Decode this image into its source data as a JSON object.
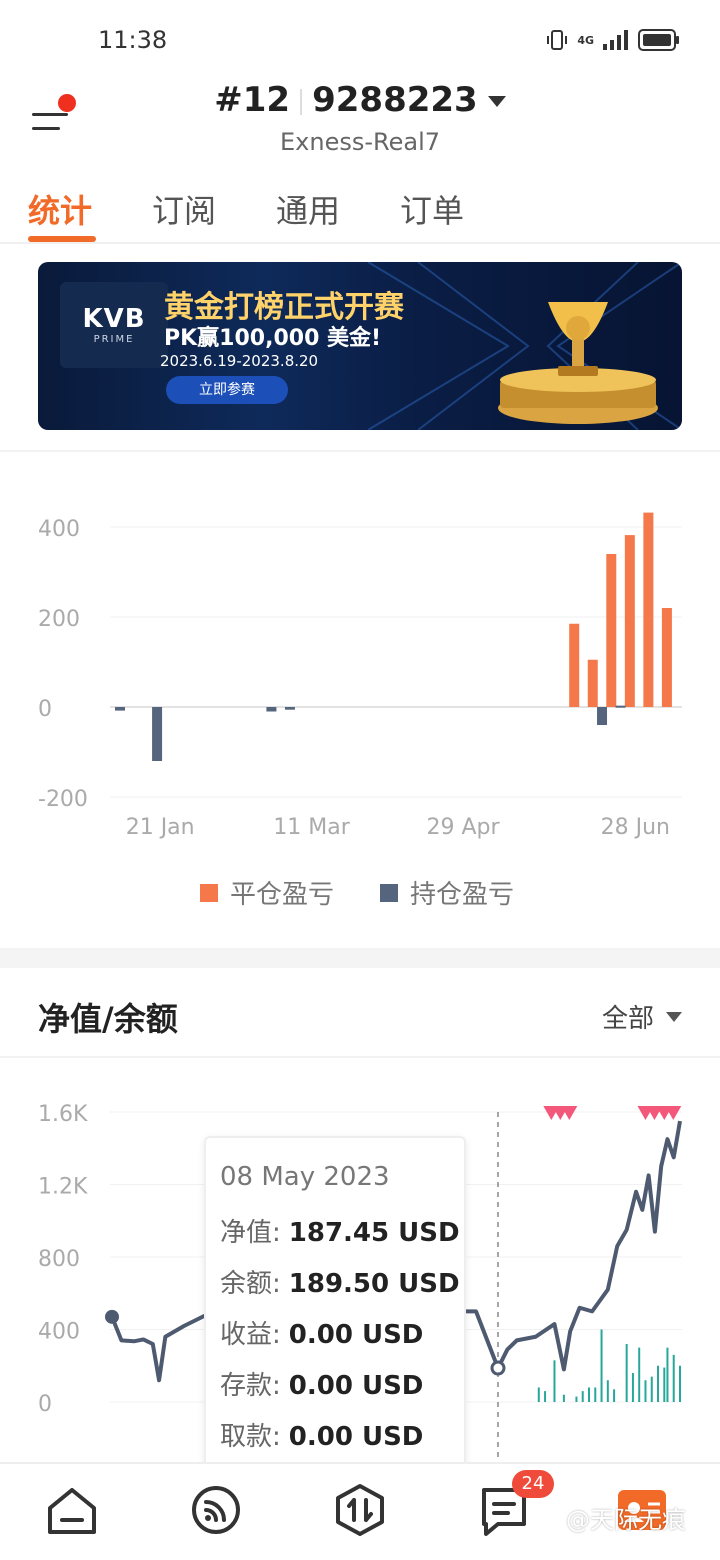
{
  "status_bar": {
    "time": "11:38",
    "network": "4G"
  },
  "header": {
    "account_prefix": "#12",
    "account_number": "9288223",
    "server": "Exness-Real7"
  },
  "tabs": [
    {
      "label": "统计",
      "active": true
    },
    {
      "label": "订阅",
      "active": false
    },
    {
      "label": "通用",
      "active": false
    },
    {
      "label": "订单",
      "active": false
    }
  ],
  "banner": {
    "logo_text": "KVB",
    "logo_sub": "PRIME",
    "title": "黄金打榜正式开赛",
    "subtitle": "PK赢100,000 美金!",
    "date_range": "2023.6.19-2023.8.20",
    "button_label": "立即参赛"
  },
  "profit_chart": {
    "y_ticks": [
      "400",
      "200",
      "0",
      "-200"
    ],
    "x_ticks": [
      "21 Jan",
      "11 Mar",
      "29 Apr",
      "28 Jun"
    ],
    "legend": [
      {
        "label": "平仓盈亏",
        "color": "#f5784a"
      },
      {
        "label": "持仓盈亏",
        "color": "#56657e"
      }
    ]
  },
  "equity_section": {
    "title": "净值/余额",
    "filter_label": "全部",
    "y_ticks": [
      "1.6K",
      "1.2K",
      "800",
      "400",
      "0"
    ],
    "tooltip": {
      "date": "08 May 2023",
      "rows": [
        {
          "label": "净值:",
          "value": "187.45 USD"
        },
        {
          "label": "余额:",
          "value": "189.50 USD"
        },
        {
          "label": "收益:",
          "value": "0.00 USD"
        },
        {
          "label": "存款:",
          "value": "0.00 USD"
        },
        {
          "label": "取款:",
          "value": "0.00 USD"
        }
      ]
    }
  },
  "bottom_nav": {
    "items": [
      "home-icon",
      "signal-icon",
      "trade-icon",
      "message-icon",
      "profile-icon"
    ],
    "message_badge": "24"
  },
  "watermark": "@天际无痕",
  "chart_data": [
    {
      "type": "bar",
      "ylim": [
        -200,
        450
      ],
      "x_range": [
        "2023-01-08",
        "2023-07-05"
      ],
      "series": [
        {
          "name": "平仓盈亏",
          "color": "#f5784a",
          "points": [
            {
              "x": "2023-06-04",
              "y": 185
            },
            {
              "x": "2023-06-10",
              "y": 105
            },
            {
              "x": "2023-06-16",
              "y": 340
            },
            {
              "x": "2023-06-22",
              "y": 382
            },
            {
              "x": "2023-06-28",
              "y": 432
            },
            {
              "x": "2023-07-04",
              "y": 220
            }
          ]
        },
        {
          "name": "持仓盈亏",
          "color": "#56657e",
          "points": [
            {
              "x": "2023-01-08",
              "y": -8
            },
            {
              "x": "2023-01-20",
              "y": -120
            },
            {
              "x": "2023-02-26",
              "y": -10
            },
            {
              "x": "2023-03-04",
              "y": -6
            },
            {
              "x": "2023-06-13",
              "y": -40
            },
            {
              "x": "2023-06-19",
              "y": 3
            }
          ]
        }
      ]
    },
    {
      "type": "line",
      "ylim": [
        0,
        1600
      ],
      "series": [
        {
          "name": "净值",
          "color": "#4e5a70",
          "x": [
            "2023-01-05",
            "2023-01-08",
            "2023-01-12",
            "2023-01-15",
            "2023-01-18",
            "2023-01-20",
            "2023-01-22",
            "2023-01-24",
            "2023-01-28",
            "2023-02-04",
            "2023-02-12",
            "2023-02-18",
            "2023-02-24",
            "2023-03-01",
            "2023-03-10",
            "2023-03-20",
            "2023-03-30",
            "2023-04-10",
            "2023-04-20",
            "2023-05-01",
            "2023-05-08",
            "2023-05-11",
            "2023-05-14",
            "2023-05-20",
            "2023-05-26",
            "2023-05-29",
            "2023-05-31",
            "2023-06-03",
            "2023-06-07",
            "2023-06-12",
            "2023-06-15",
            "2023-06-18",
            "2023-06-21",
            "2023-06-23",
            "2023-06-25",
            "2023-06-27",
            "2023-06-29",
            "2023-07-01",
            "2023-07-03",
            "2023-07-05"
          ],
          "y": [
            470,
            340,
            335,
            345,
            320,
            120,
            360,
            380,
            420,
            480,
            500,
            505,
            500,
            500,
            500,
            500,
            500,
            500,
            500,
            500,
            187,
            290,
            340,
            360,
            430,
            180,
            390,
            520,
            500,
            620,
            860,
            950,
            1160,
            1060,
            1250,
            940,
            1300,
            1450,
            1350,
            1550
          ]
        }
      ],
      "deposits": [
        {
          "x": "2023-05-21",
          "y": 80
        },
        {
          "x": "2023-05-23",
          "y": 60
        },
        {
          "x": "2023-05-26",
          "y": 230
        },
        {
          "x": "2023-05-29",
          "y": 40
        },
        {
          "x": "2023-06-02",
          "y": 30
        },
        {
          "x": "2023-06-04",
          "y": 60
        },
        {
          "x": "2023-06-06",
          "y": 80
        },
        {
          "x": "2023-06-08",
          "y": 80
        },
        {
          "x": "2023-06-10",
          "y": 400
        },
        {
          "x": "2023-06-12",
          "y": 120
        },
        {
          "x": "2023-06-14",
          "y": 70
        },
        {
          "x": "2023-06-18",
          "y": 320
        },
        {
          "x": "2023-06-20",
          "y": 160
        },
        {
          "x": "2023-06-22",
          "y": 300
        },
        {
          "x": "2023-06-24",
          "y": 120
        },
        {
          "x": "2023-06-26",
          "y": 140
        },
        {
          "x": "2023-06-28",
          "y": 200
        },
        {
          "x": "2023-06-30",
          "y": 190
        },
        {
          "x": "2023-07-01",
          "y": 300
        },
        {
          "x": "2023-07-03",
          "y": 260
        },
        {
          "x": "2023-07-05",
          "y": 200
        }
      ]
    }
  ]
}
